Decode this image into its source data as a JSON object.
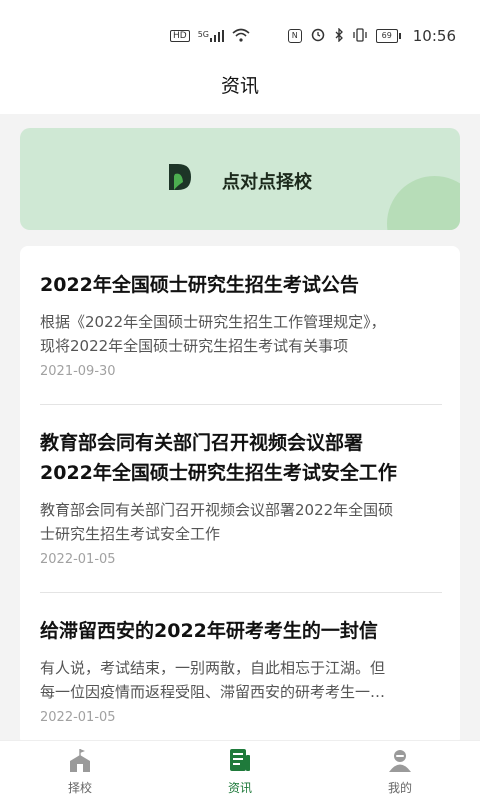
{
  "status_bar": {
    "time": "10:56",
    "battery": "69",
    "network": "5G",
    "icons": [
      "hd-icon",
      "signal-icon",
      "wifi-icon",
      "nfc-icon",
      "alarm-icon",
      "bluetooth-icon",
      "vibrate-icon",
      "battery-icon"
    ]
  },
  "header": {
    "title": "资讯"
  },
  "banner": {
    "text": "点对点择校",
    "colors": {
      "background": "#cfe8d4",
      "logo_dark": "#1d3527",
      "logo_green": "#4caf50"
    }
  },
  "news": [
    {
      "title_line1": "2022年全国硕士研究生招生考试公告",
      "title_line2": "",
      "summary_line1": "根据《2022年全国硕士研究生招生工作管理规定》，",
      "summary_line2": "现将2022年全国硕士研究生招生考试有关事项",
      "date": "2021-09-30"
    },
    {
      "title_line1": "教育部会同有关部门召开视频会议部署",
      "title_line2": "2022年全国硕士研究生招生考试安全工作",
      "summary_line1": "教育部会同有关部门召开视频会议部署2022年全国硕",
      "summary_line2": "士研究生招生考试安全工作",
      "date": "2022-01-05"
    },
    {
      "title_line1": "给滞留西安的2022年研考考生的一封信",
      "title_line2": "",
      "summary_line1": "有人说，考试结束，一别两散，自此相忘于江湖。但",
      "summary_line2": "每一位因疫情而返程受阻、滞留西安的研考考生一…",
      "date": "2022-01-05"
    }
  ],
  "tabbar": {
    "tabs": [
      {
        "label": "择校",
        "icon": "school-icon",
        "active": false
      },
      {
        "label": "资讯",
        "icon": "news-icon",
        "active": true
      },
      {
        "label": "我的",
        "icon": "profile-icon",
        "active": false
      }
    ],
    "active_color": "#1f7a3b",
    "inactive_color": "#9a9a9a"
  }
}
